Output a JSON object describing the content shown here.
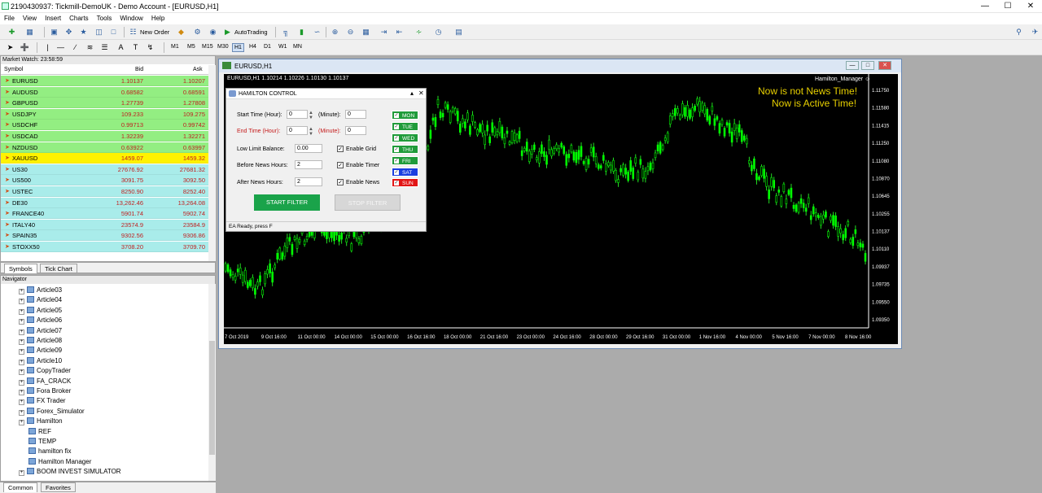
{
  "window": {
    "title": "2190430937: Tickmill-DemoUK - Demo Account - [EURUSD,H1]"
  },
  "menu": [
    "File",
    "View",
    "Insert",
    "Charts",
    "Tools",
    "Window",
    "Help"
  ],
  "toolbar": {
    "new_order": "New Order",
    "autotrading": "AutoTrading",
    "timeframes": [
      "M1",
      "M5",
      "M15",
      "M30",
      "H1",
      "H4",
      "D1",
      "W1",
      "MN"
    ]
  },
  "market_watch": {
    "title": "Market Watch: 23:58:59",
    "columns": [
      "Symbol",
      "Bid",
      "Ask"
    ],
    "rows": [
      {
        "symbol": "EURUSD",
        "bid": "1.10137",
        "ask": "1.10207",
        "color": "#93ee82"
      },
      {
        "symbol": "AUDUSD",
        "bid": "0.68582",
        "ask": "0.68591",
        "color": "#93ee82"
      },
      {
        "symbol": "GBPUSD",
        "bid": "1.27739",
        "ask": "1.27808",
        "color": "#93ee82"
      },
      {
        "symbol": "USDJPY",
        "bid": "109.233",
        "ask": "109.275",
        "color": "#93ee82"
      },
      {
        "symbol": "USDCHF",
        "bid": "0.99713",
        "ask": "0.99742",
        "color": "#93ee82"
      },
      {
        "symbol": "USDCAD",
        "bid": "1.32239",
        "ask": "1.32271",
        "color": "#93ee82"
      },
      {
        "symbol": "NZDUSD",
        "bid": "0.63922",
        "ask": "0.63997",
        "color": "#93ee82"
      },
      {
        "symbol": "XAUUSD",
        "bid": "1459.07",
        "ask": "1459.32",
        "color": "#fff200"
      },
      {
        "symbol": "US30",
        "bid": "27676.92",
        "ask": "27681.32",
        "color": "#a9ecea"
      },
      {
        "symbol": "US500",
        "bid": "3091.75",
        "ask": "3092.50",
        "color": "#a9ecea"
      },
      {
        "symbol": "USTEC",
        "bid": "8250.90",
        "ask": "8252.40",
        "color": "#a9ecea"
      },
      {
        "symbol": "DE30",
        "bid": "13,262.46",
        "ask": "13,264.08",
        "color": "#a9ecea"
      },
      {
        "symbol": "FRANCE40",
        "bid": "5901.74",
        "ask": "5902.74",
        "color": "#a9ecea"
      },
      {
        "symbol": "ITALY40",
        "bid": "23574.9",
        "ask": "23584.9",
        "color": "#a9ecea"
      },
      {
        "symbol": "SPAIN35",
        "bid": "9302.56",
        "ask": "9306.86",
        "color": "#a9ecea"
      },
      {
        "symbol": "STOXX50",
        "bid": "3708.20",
        "ask": "3709.70",
        "color": "#a9ecea"
      }
    ],
    "tabs": [
      "Symbols",
      "Tick Chart"
    ]
  },
  "navigator": {
    "title": "Navigator",
    "items": [
      "Article03",
      "Article04",
      "Article05",
      "Article06",
      "Article07",
      "Article08",
      "Article09",
      "Article10",
      "CopyTrader",
      "FA_CRACK",
      "Fora Broker",
      "FX Trader",
      "Forex_Simulator",
      "Hamilton",
      "REF",
      "TEMP",
      "hamilton fix",
      "Hamilton Manager",
      "BOOM INVEST SIMULATOR"
    ],
    "tabs": [
      "Common",
      "Favorites"
    ]
  },
  "chart": {
    "title": "EURUSD,H1",
    "ohlc": "EURUSD,H1  1.10214 1.10226 1.10130 1.10137",
    "expert": "Hamilton_Manager ☺",
    "note1": "Now is not News Time!",
    "note2": "Now is Active Time!",
    "price_labels": [
      "1.11750",
      "1.11580",
      "1.11415",
      "1.11250",
      "1.11080",
      "1.10870",
      "1.10645",
      "1.10255",
      "1.10137",
      "1.10110",
      "1.09937",
      "1.09735",
      "1.09550",
      "1.09350"
    ],
    "time_labels": [
      "7 Oct 2019",
      "9 Oct 16:00",
      "11 Oct 00:00",
      "14 Oct 00:00",
      "15 Oct 00:00",
      "16 Oct 16:00",
      "18 Oct 00:00",
      "21 Oct 16:00",
      "23 Oct 00:00",
      "24 Oct 16:00",
      "28 Oct 00:00",
      "29 Oct 16:00",
      "31 Oct 00:00",
      "1 Nov 16:00",
      "4 Nov 00:00",
      "5 Nov 16:00",
      "7 Nov 00:00",
      "8 Nov 16:00"
    ]
  },
  "panel": {
    "title": "HAMILTON CONTROL",
    "start_label": "Start Time (Hour):",
    "start_hour": "0",
    "start_min_label": "(Minute):",
    "start_min": "0",
    "end_label": "End Time (Hour):",
    "end_hour": "0",
    "end_min_label": "(Minute):",
    "end_min": "0",
    "balance_label": "Low Limit Balance:",
    "balance": "0.00",
    "before_label": "Before News Hours:",
    "before": "2",
    "after_label": "After News Hours:",
    "after": "2",
    "enable_grid": "Enable Grid",
    "enable_timer": "Enable Timer",
    "enable_news": "Enable News",
    "days": [
      {
        "label": "MON",
        "color": "#1f9b3a"
      },
      {
        "label": "TUE",
        "color": "#1f9b3a"
      },
      {
        "label": "WED",
        "color": "#1f9b3a"
      },
      {
        "label": "THU",
        "color": "#1f9b3a"
      },
      {
        "label": "FRI",
        "color": "#1f9b3a"
      },
      {
        "label": "SAT",
        "color": "#1a3ee0"
      },
      {
        "label": "SUN",
        "color": "#e21515"
      }
    ],
    "start_button": "START FILTER",
    "stop_button": "STOP FILTER",
    "status": "EA Ready, press F"
  }
}
